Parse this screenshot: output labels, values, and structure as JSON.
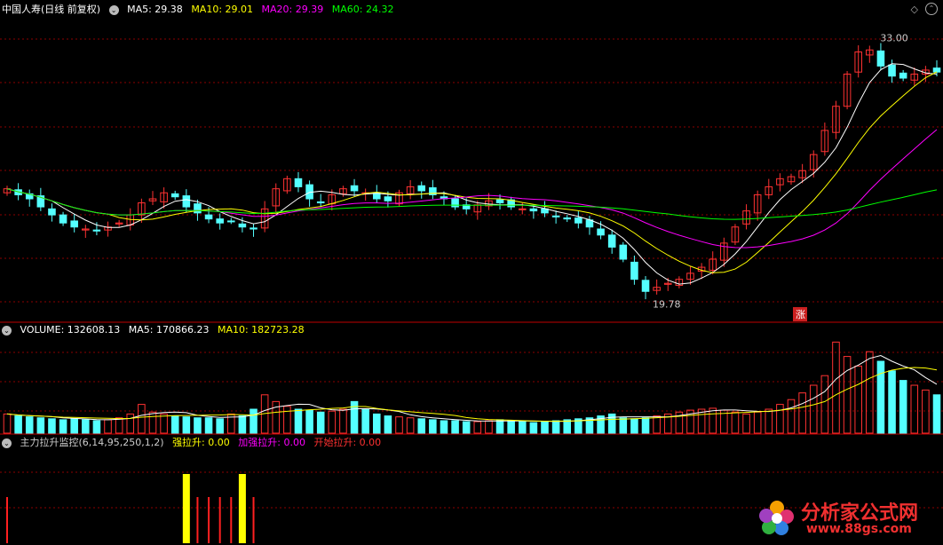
{
  "header": {
    "title": "中国人寿(日线 前复权)",
    "ma5": "MA5: 29.38",
    "ma10": "MA10: 29.01",
    "ma20": "MA20: 29.39",
    "ma60": "MA60: 24.32"
  },
  "volume_header": {
    "label": "VOLUME: 132608.13",
    "ma5": "MA5: 170866.23",
    "ma10": "MA10: 182723.28"
  },
  "indicator_header": {
    "name": "主力拉升监控(6,14,95,250,1,2)",
    "strong": "强拉升: 0.00",
    "add": "加强拉升: 0.00",
    "start": "开始拉升: 0.00"
  },
  "annotations": {
    "high": "33.00",
    "low": "19.78",
    "marker": "涨"
  },
  "watermark": {
    "line1": "分析家公式网",
    "line2": "www.88gs.com"
  },
  "colors": {
    "up": "#ff3232",
    "down": "#54ffff",
    "ma5": "#ffffff",
    "ma10": "#ffff00",
    "ma20": "#ff00ff",
    "ma60": "#00ff00",
    "grid": "#8b0000",
    "signal_red": "#ff2020",
    "signal_yellow": "#ffff00"
  },
  "icons": {
    "collapse": "chevron-down-icon",
    "settings": "diamond-icon",
    "toggle": "up-circle-icon"
  },
  "chart_data": [
    {
      "type": "candlestick",
      "title": "中国人寿(日线 前复权)",
      "ylim": [
        19,
        34
      ],
      "high_label": 33.0,
      "low_label": 19.78,
      "note": "approx. daily closes estimated from gridlines",
      "closes": [
        25.5,
        25.2,
        25.0,
        24.6,
        24.2,
        23.8,
        23.6,
        23.5,
        23.4,
        23.6,
        23.8,
        24.2,
        24.8,
        25.0,
        25.3,
        25.1,
        24.6,
        24.3,
        24.0,
        23.8,
        23.9,
        23.6,
        23.5,
        24.5,
        25.5,
        26.0,
        25.6,
        25.0,
        24.8,
        25.2,
        25.5,
        25.4,
        25.3,
        25.0,
        24.9,
        25.3,
        25.6,
        25.4,
        25.2,
        25.0,
        24.6,
        24.5,
        24.7,
        24.9,
        24.8,
        24.6,
        24.5,
        24.4,
        24.3,
        24.1,
        24.0,
        23.8,
        23.6,
        23.2,
        22.6,
        22.0,
        21.0,
        20.4,
        20.6,
        20.8,
        21.0,
        21.3,
        21.6,
        22.0,
        22.8,
        23.6,
        24.4,
        25.2,
        25.6,
        26.0,
        26.1,
        26.4,
        27.2,
        28.4,
        29.6,
        31.2,
        32.3,
        32.4,
        31.6,
        31.1,
        31.0,
        31.2,
        31.4,
        31.3
      ],
      "ma_values": {
        "MA5": 29.38,
        "MA10": 29.01,
        "MA20": 29.39,
        "MA60": 24.32
      }
    },
    {
      "type": "bar",
      "title": "VOLUME",
      "values_last": {
        "VOLUME": 132608.13,
        "MA5": 170866.23,
        "MA10": 182723.28
      },
      "note": "relative volume heights (0-1)",
      "values": [
        0.2,
        0.18,
        0.17,
        0.16,
        0.15,
        0.14,
        0.15,
        0.14,
        0.13,
        0.14,
        0.16,
        0.2,
        0.3,
        0.22,
        0.2,
        0.18,
        0.17,
        0.16,
        0.16,
        0.15,
        0.2,
        0.18,
        0.25,
        0.4,
        0.33,
        0.28,
        0.25,
        0.24,
        0.22,
        0.23,
        0.25,
        0.33,
        0.25,
        0.2,
        0.18,
        0.17,
        0.16,
        0.15,
        0.14,
        0.13,
        0.13,
        0.12,
        0.12,
        0.13,
        0.14,
        0.13,
        0.12,
        0.11,
        0.12,
        0.13,
        0.14,
        0.15,
        0.16,
        0.18,
        0.2,
        0.16,
        0.15,
        0.16,
        0.18,
        0.2,
        0.22,
        0.24,
        0.25,
        0.26,
        0.24,
        0.22,
        0.2,
        0.22,
        0.25,
        0.3,
        0.35,
        0.42,
        0.5,
        0.6,
        0.95,
        0.8,
        0.7,
        0.85,
        0.75,
        0.65,
        0.55,
        0.5,
        0.45,
        0.4
      ]
    },
    {
      "type": "bar",
      "title": "主力拉升监控",
      "note": "signal bars: 1 = red signal, 2 = yellow strong signal",
      "values": [
        1,
        0,
        0,
        0,
        0,
        0,
        0,
        0,
        0,
        0,
        0,
        0,
        0,
        0,
        0,
        0,
        2,
        1,
        1,
        1,
        1,
        2,
        1,
        0,
        0,
        0,
        0,
        0,
        0,
        0,
        0,
        0,
        0,
        0,
        0,
        0,
        0,
        0,
        0,
        0,
        0,
        0,
        0,
        0,
        0,
        0,
        0,
        0,
        0,
        0,
        0,
        0,
        0,
        0,
        0,
        0,
        0,
        0,
        0,
        0,
        0,
        0,
        0,
        0,
        0,
        0,
        0,
        0,
        0,
        0,
        0,
        0,
        0,
        0,
        0,
        0,
        0,
        0,
        0,
        0,
        0,
        0,
        0,
        0
      ]
    }
  ]
}
